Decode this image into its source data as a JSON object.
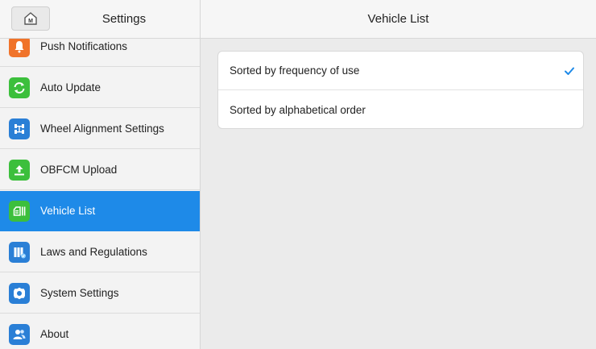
{
  "sidebar": {
    "title": "Settings",
    "home_icon": "home-m-icon",
    "items": [
      {
        "label": "Push Notifications",
        "icon": "bell-icon",
        "color": "#f0732a",
        "active": false
      },
      {
        "label": "Auto Update",
        "icon": "refresh-icon",
        "color": "#3cbf3c",
        "active": false
      },
      {
        "label": "Wheel Alignment Settings",
        "icon": "wheel-alignment-icon",
        "color": "#2a7fd6",
        "active": false
      },
      {
        "label": "OBFCM Upload",
        "icon": "upload-icon",
        "color": "#3cbf3c",
        "active": false
      },
      {
        "label": "Vehicle List",
        "icon": "vehicle-list-icon",
        "color": "#3cbf3c",
        "active": true
      },
      {
        "label": "Laws and Regulations",
        "icon": "books-icon",
        "color": "#2a7fd6",
        "active": false
      },
      {
        "label": "System Settings",
        "icon": "gear-icon",
        "color": "#2a7fd6",
        "active": false
      },
      {
        "label": "About",
        "icon": "people-icon",
        "color": "#2a7fd6",
        "active": false
      }
    ]
  },
  "main": {
    "title": "Vehicle List",
    "options": [
      {
        "label": "Sorted by frequency of use",
        "selected": true
      },
      {
        "label": "Sorted by alphabetical order",
        "selected": false
      }
    ]
  },
  "colors": {
    "accent": "#1e8ae8",
    "check": "#1e8ae8"
  }
}
